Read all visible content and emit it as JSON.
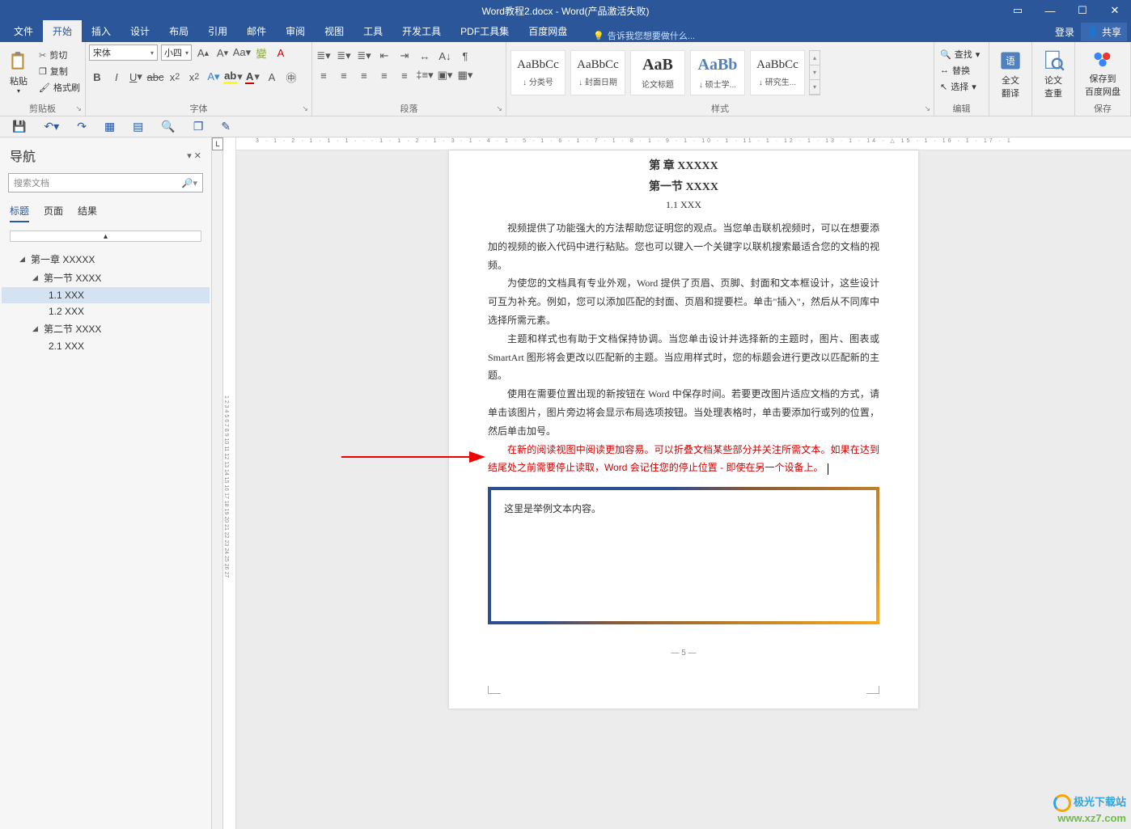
{
  "titlebar": {
    "title": "Word教程2.docx - Word(产品激活失败)"
  },
  "menubar": {
    "tabs": [
      "文件",
      "开始",
      "插入",
      "设计",
      "布局",
      "引用",
      "邮件",
      "审阅",
      "视图",
      "工具",
      "开发工具",
      "PDF工具集",
      "百度网盘"
    ],
    "activeIndex": 1,
    "tell_me": "告诉我您想要做什么...",
    "login": "登录",
    "share": "共享"
  },
  "ribbon": {
    "clipboard": {
      "paste": "粘贴",
      "cut": "剪切",
      "copy": "复制",
      "format_painter": "格式刷",
      "group": "剪贴板"
    },
    "font": {
      "name": "宋体",
      "size": "小四",
      "group": "字体"
    },
    "paragraph": {
      "group": "段落"
    },
    "styles": {
      "items": [
        {
          "preview": "AaBbCc",
          "label": "↓ 分类号"
        },
        {
          "preview": "AaBbCc",
          "label": "↓ 封面日期"
        },
        {
          "preview": "AaB",
          "label": "论文标题",
          "big": true
        },
        {
          "preview": "AaBb",
          "label": "↓ 硕士学...",
          "big": true,
          "blue": true
        },
        {
          "preview": "AaBbCc",
          "label": "↓ 研究生..."
        }
      ],
      "group": "样式"
    },
    "editing": {
      "find": "查找",
      "replace": "替换",
      "select": "选择",
      "group": "编辑"
    },
    "translate": {
      "line1": "全文",
      "line2": "翻译"
    },
    "lookup": {
      "line1": "论文",
      "line2": "查重"
    },
    "save_baidu": {
      "line1": "保存到",
      "line2": "百度网盘",
      "group": "保存"
    }
  },
  "nav": {
    "title": "导航",
    "search_placeholder": "搜索文档",
    "tabs": [
      "标题",
      "页面",
      "结果"
    ],
    "tree": [
      {
        "level": 1,
        "text": "第一章 XXXXX",
        "expanded": true
      },
      {
        "level": 2,
        "text": "第一节 XXXX",
        "expanded": true
      },
      {
        "level": 3,
        "text": "1.1 XXX",
        "selected": true
      },
      {
        "level": 3,
        "text": "1.2 XXX"
      },
      {
        "level": 2,
        "text": "第二节 XXXX",
        "expanded": true
      },
      {
        "level": 3,
        "text": "2.1 XXX"
      }
    ]
  },
  "ruler": {
    "top": "3 · 1 · 2 · 1 · 1 · 1 · · · 1 · 1 · 2 · 1 · 3 · 1 · 4 · 1 · 5 · 1 · 6 · 1 · 7 · 1 · 8 · 1 · 9 · 1 · 10 · 1 · 11 · 1 · 12 · 1 · 13 · 1 · 14 · △ 15 · 1 · 16 · 1 · 17 · 1"
  },
  "document": {
    "h0": "第  章 XXXXX",
    "h1": "第一节  XXXX",
    "h2": "1.1 XXX",
    "p1": "视频提供了功能强大的方法帮助您证明您的观点。当您单击联机视频时，可以在想要添加的视频的嵌入代码中进行粘贴。您也可以键入一个关键字以联机搜索最适合您的文档的视频。",
    "p2": "为使您的文档具有专业外观，Word 提供了页眉、页脚、封面和文本框设计，这些设计可互为补充。例如，您可以添加匹配的封面、页眉和提要栏。单击\"插入\"，然后从不同库中选择所需元素。",
    "p3": "主题和样式也有助于文档保持协调。当您单击设计并选择新的主题时，图片、图表或 SmartArt 图形将会更改以匹配新的主题。当应用样式时，您的标题会进行更改以匹配新的主题。",
    "p4": "使用在需要位置出现的新按钮在 Word 中保存时间。若要更改图片适应文档的方式，请单击该图片，图片旁边将会显示布局选项按钮。当处理表格时，单击要添加行或列的位置，然后单击加号。",
    "p5": "在新的阅读视图中阅读更加容易。可以折叠文档某些部分并关注所需文本。如果在达到结尾处之前需要停止读取，Word 会记住您的停止位置 - 即使在另一个设备上。",
    "textbox": "这里是举例文本内容。",
    "pagenum": "— 5 —"
  },
  "watermark": {
    "l1": "极光下载站",
    "l2": "www.xz7.com"
  }
}
